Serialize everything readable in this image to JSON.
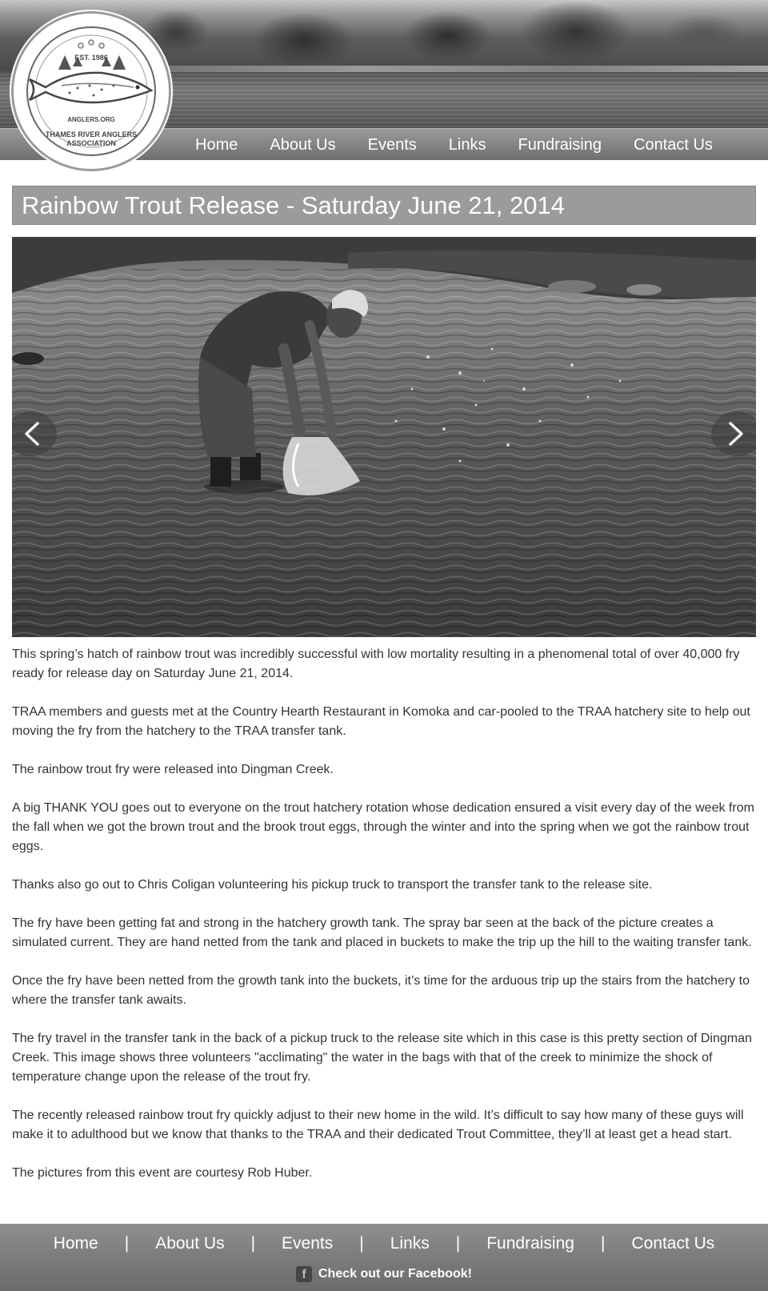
{
  "logo": {
    "established": "EST. 1986",
    "website": "ANGLERS.ORG",
    "organization": "THAMES RIVER ANGLERS ASSOCIATION"
  },
  "nav": {
    "items": [
      {
        "label": "Home"
      },
      {
        "label": "About Us"
      },
      {
        "label": "Events"
      },
      {
        "label": "Links"
      },
      {
        "label": "Fundraising"
      },
      {
        "label": "Contact Us"
      }
    ]
  },
  "main": {
    "title": "Rainbow Trout Release - Saturday June 21, 2014",
    "paragraphs": [
      "This spring’s hatch of rainbow trout was incredibly successful with low mortality resulting in a phenomenal total of over 40,000 fry ready for release day on Saturday June 21, 2014.",
      "TRAA members and guests met at the Country Hearth Restaurant in Komoka and car-pooled to the TRAA hatchery site to help out moving the fry from the hatchery to the TRAA transfer tank.",
      "The rainbow trout fry were released into Dingman Creek.",
      "A big THANK YOU goes out to everyone on the trout hatchery rotation whose dedication ensured a visit every day of the week from the fall when we got the brown trout and the brook trout eggs, through the winter and into the spring when we got the rainbow trout eggs.",
      "Thanks also go out to Chris Coligan volunteering his pickup truck to transport the transfer tank to the release site.",
      "The fry have been getting fat and strong in the hatchery growth tank. The spray bar seen at the back of the picture creates a simulated current. They are hand netted from the tank and placed in buckets to make the trip up the hill to the waiting transfer tank.",
      "Once the fry have been netted from the growth tank into the buckets, it’s time for the arduous trip up the stairs from the hatchery to where the transfer tank awaits.",
      "The fry travel in the transfer tank in the back of a pickup truck to the release site which in this case is this pretty section of Dingman Creek. This image shows three volunteers \"acclimating\" the water in the bags with that of the creek to minimize the shock of temperature change upon the release of the trout fry.",
      "The recently released rainbow trout fry quickly adjust to their new home in the wild. It’s difficult to say how many of these guys will make it to adulthood but we know that thanks to the TRAA and their dedicated Trout Committee, they’ll at least get a head start.",
      "The pictures from this event are courtesy Rob Huber."
    ]
  },
  "footer": {
    "links": [
      {
        "label": "Home"
      },
      {
        "label": "About Us"
      },
      {
        "label": "Events"
      },
      {
        "label": "Links"
      },
      {
        "label": "Fundraising"
      },
      {
        "label": "Contact Us"
      }
    ],
    "separator": "|",
    "facebook_icon": "f",
    "facebook_text": "Check out our Facebook!"
  },
  "icons": {
    "prev": "chevron-left-icon",
    "next": "chevron-right-icon",
    "facebook": "facebook-icon"
  },
  "colors": {
    "title_bar": "#9b9b9b",
    "nav_bar": "#858585",
    "footer": "#7a7a7a",
    "text": "#333333"
  }
}
